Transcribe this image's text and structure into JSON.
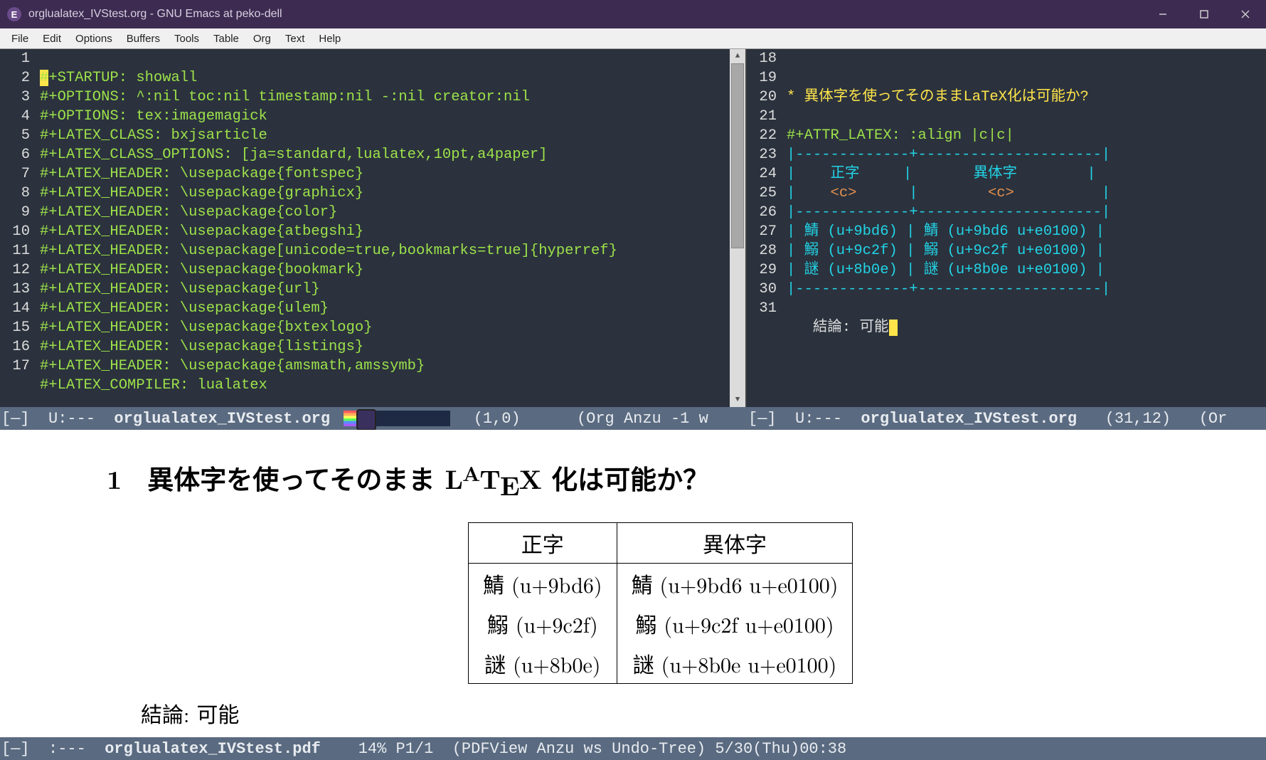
{
  "title": "orglualatex_IVStest.org - GNU Emacs at peko-dell",
  "menu": [
    "File",
    "Edit",
    "Options",
    "Buffers",
    "Tools",
    "Table",
    "Org",
    "Text",
    "Help"
  ],
  "left": {
    "nums": [
      "1",
      "2",
      "3",
      "4",
      "5",
      "6",
      "7",
      "8",
      "9",
      "10",
      "11",
      "12",
      "13",
      "14",
      "15",
      "16",
      "17"
    ],
    "l1a": "#",
    "l1b": "+STARTUP: showall",
    "l2": "#+OPTIONS: ^:nil toc:nil timestamp:nil -:nil creator:nil",
    "l3": "#+OPTIONS: tex:imagemagick",
    "l4": "#+LATEX_CLASS: bxjsarticle",
    "l5": "#+LATEX_CLASS_OPTIONS: [ja=standard,lualatex,10pt,a4paper]",
    "l6": "#+LATEX_HEADER: \\usepackage{fontspec}",
    "l7": "#+LATEX_HEADER: \\usepackage{graphicx}",
    "l8": "#+LATEX_HEADER: \\usepackage{color}",
    "l9": "#+LATEX_HEADER: \\usepackage{atbegshi}",
    "l10": "#+LATEX_HEADER: \\usepackage[unicode=true,bookmarks=true]{hyperref}",
    "l11": "#+LATEX_HEADER: \\usepackage{bookmark}",
    "l12": "#+LATEX_HEADER: \\usepackage{url}",
    "l13": "#+LATEX_HEADER: \\usepackage{ulem}",
    "l14": "#+LATEX_HEADER: \\usepackage{bxtexlogo}",
    "l15": "#+LATEX_HEADER: \\usepackage{listings}",
    "l16": "#+LATEX_HEADER: \\usepackage{amsmath,amssymb}",
    "l17": "#+LATEX_COMPILER: lualatex"
  },
  "right": {
    "nums": [
      "18",
      "19",
      "20",
      "21",
      "22",
      "23",
      "24",
      "25",
      "26",
      "27",
      "28",
      "29",
      "30",
      "31"
    ],
    "heading_star": "* ",
    "heading": "異体字を使ってそのままLaTeX化は可能か?",
    "attr": "#+ATTR_LATEX: :align |c|c|",
    "sep": "|-------------+---------------------|",
    "hdr_l": "正字",
    "hdr_r": "異体字",
    "c_l": "<c>",
    "c_r": "<c>",
    "r1_l": "鯖 (u+9bd6)",
    "r1_r": "鯖 (u+9bd6 u+e0100)",
    "r2_l": "鰯 (u+9c2f)",
    "r2_r": "鰯 (u+9c2f u+e0100)",
    "r3_l": "謎 (u+8b0e)",
    "r3_r": "謎 (u+8b0e u+e0100)",
    "conc_pre": "   結論: 可能"
  },
  "mode_left": {
    "pre": "[—]  U:--- ",
    "fname": " orglualatex_IVStest.org ",
    "pos": "  (1,0)      ",
    "mode": "(Org Anzu -1 w"
  },
  "mode_right": {
    "pre": "[—]  U:--- ",
    "fname": " orglualatex_IVStest.org ",
    "pos": "  (31,12)   ",
    "tail": "(Or"
  },
  "mode_pdf": {
    "pre": "[—]  :--- ",
    "fname": " orglualatex_IVStest.pdf ",
    "mid": "   14% P1/1  (PDFView Anzu ws Undo-Tree) 5/30(Thu)00:38"
  },
  "doc": {
    "num": "1",
    "heading_pre": "異体字を使ってそのまま ",
    "heading_post": " 化は可能か？",
    "th1": "正字",
    "th2": "異体字",
    "r1c1": "鯖 (u+9bd6)",
    "r1c2": "鯖 (u+9bd6 u+e0100)",
    "r2c1": "鰯 (u+9c2f)",
    "r2c2": "鰯 (u+9c2f u+e0100)",
    "r3c1": "謎 (u+8b0e)",
    "r3c2": "謎 (u+8b0e u+e0100)",
    "conc": "結論: 可能"
  }
}
